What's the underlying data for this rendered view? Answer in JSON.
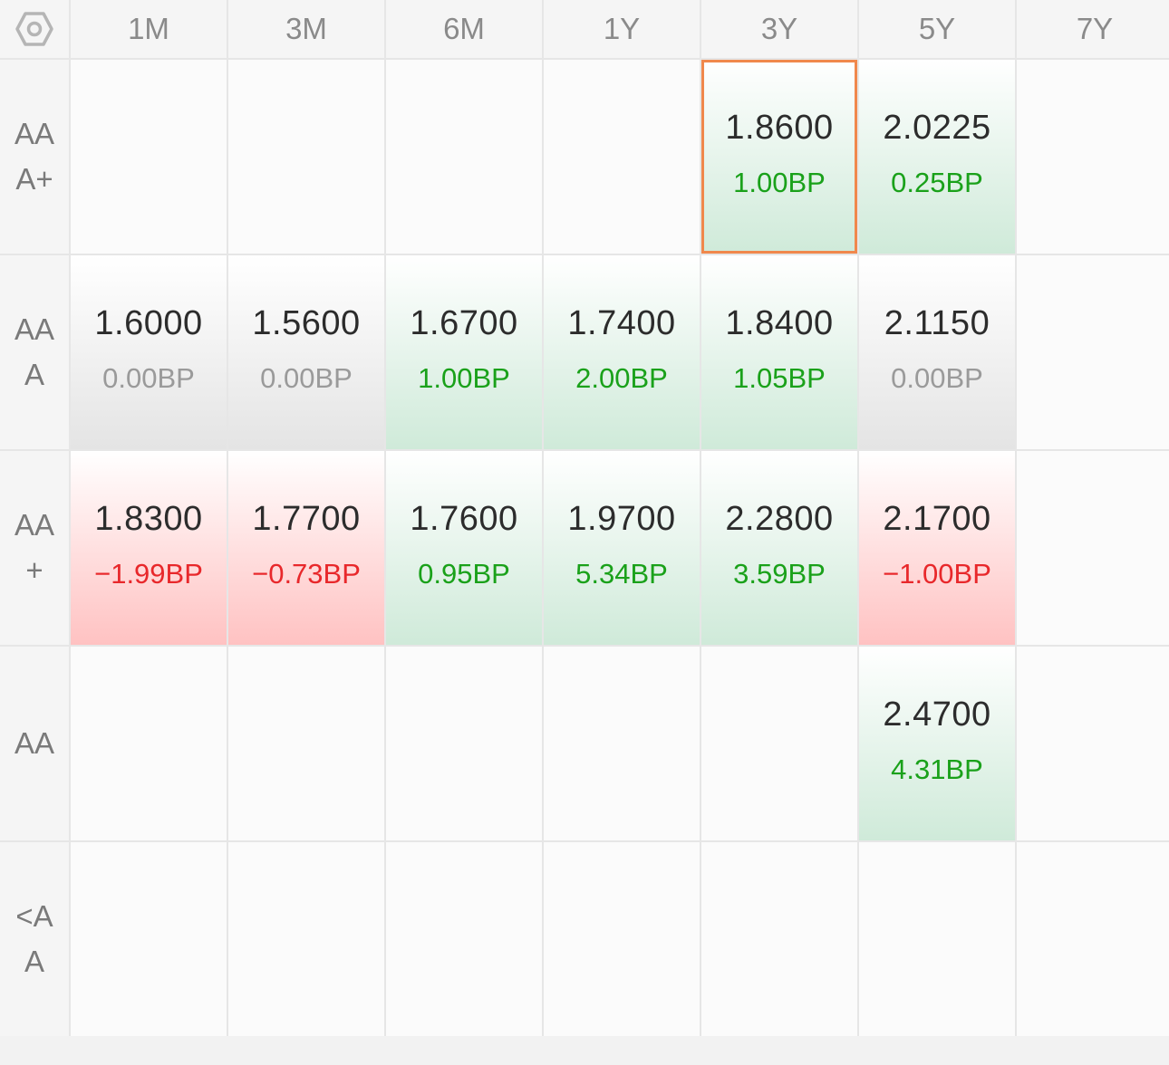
{
  "settings_icon": "hexagon-gear-icon",
  "columns": [
    "1M",
    "3M",
    "6M",
    "1Y",
    "3Y",
    "5Y",
    "7Y"
  ],
  "rows": [
    {
      "label": "AAA+",
      "cells": [
        null,
        null,
        null,
        null,
        {
          "value": "1.8600",
          "change": "1.00BP",
          "trend": "pos",
          "selected": true
        },
        {
          "value": "2.0225",
          "change": "0.25BP",
          "trend": "pos"
        },
        null
      ]
    },
    {
      "label": "AAA",
      "cells": [
        {
          "value": "1.6000",
          "change": "0.00BP",
          "trend": "flat"
        },
        {
          "value": "1.5600",
          "change": "0.00BP",
          "trend": "flat"
        },
        {
          "value": "1.6700",
          "change": "1.00BP",
          "trend": "pos"
        },
        {
          "value": "1.7400",
          "change": "2.00BP",
          "trend": "pos"
        },
        {
          "value": "1.8400",
          "change": "1.05BP",
          "trend": "pos"
        },
        {
          "value": "2.1150",
          "change": "0.00BP",
          "trend": "flat"
        },
        null
      ]
    },
    {
      "label": "AA+",
      "cells": [
        {
          "value": "1.8300",
          "change": "−1.99BP",
          "trend": "neg"
        },
        {
          "value": "1.7700",
          "change": "−0.73BP",
          "trend": "neg"
        },
        {
          "value": "1.7600",
          "change": "0.95BP",
          "trend": "pos"
        },
        {
          "value": "1.9700",
          "change": "5.34BP",
          "trend": "pos"
        },
        {
          "value": "2.2800",
          "change": "3.59BP",
          "trend": "pos"
        },
        {
          "value": "2.1700",
          "change": "−1.00BP",
          "trend": "neg"
        },
        null
      ]
    },
    {
      "label": "AA",
      "cells": [
        null,
        null,
        null,
        null,
        null,
        {
          "value": "2.4700",
          "change": "4.31BP",
          "trend": "pos"
        },
        null
      ]
    },
    {
      "label": "<AA",
      "cells": [
        null,
        null,
        null,
        null,
        null,
        null,
        null
      ]
    }
  ]
}
